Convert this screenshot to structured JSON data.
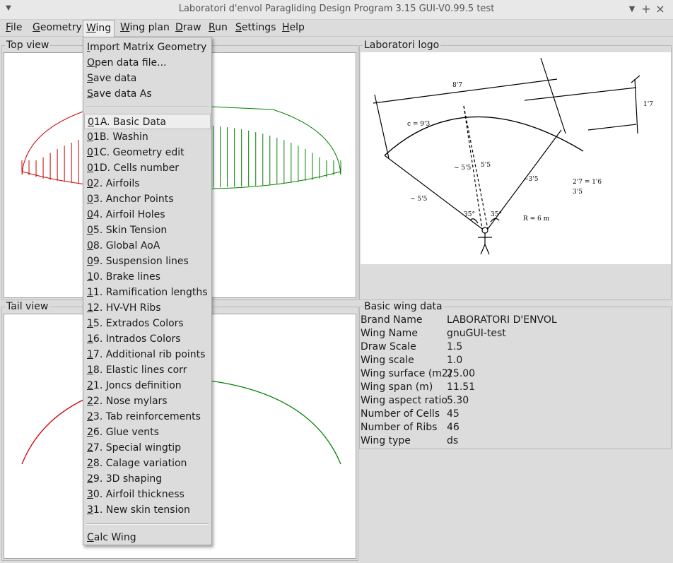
{
  "window": {
    "title": "Laboratori d'envol Paragliding Design Program 3.15 GUI-V0.99.5 test",
    "icon_name": "window-menu-icon",
    "buttons": [
      "chevron-down-icon",
      "maximize-icon",
      "close-icon"
    ]
  },
  "menubar": {
    "items": [
      {
        "mnemonic": "F",
        "rest": "ile"
      },
      {
        "mnemonic": "G",
        "rest": "eometry"
      },
      {
        "mnemonic": "W",
        "rest": "ing"
      },
      {
        "mnemonic": "W",
        "rest": "ing plan"
      },
      {
        "mnemonic": "D",
        "rest": "raw"
      },
      {
        "mnemonic": "R",
        "rest": "un"
      },
      {
        "mnemonic": "S",
        "rest": "ettings"
      },
      {
        "mnemonic": "H",
        "rest": "elp"
      }
    ]
  },
  "panels": {
    "top_view": "Top view",
    "logo": "Laboratori logo",
    "tail_view": "Tail view",
    "basic_data": "Basic wing data"
  },
  "colors": {
    "left_half": "#cc0000",
    "right_half": "#008000"
  },
  "basic_wing_data": [
    {
      "key": "Brand Name",
      "value": "LABORATORI D'ENVOL"
    },
    {
      "key": "Wing Name",
      "value": "gnuGUI-test"
    },
    {
      "key": "Draw Scale",
      "value": "1.5"
    },
    {
      "key": "Wing scale",
      "value": "1.0"
    },
    {
      "key": "Wing surface (m2)",
      "value": "25.00"
    },
    {
      "key": "Wing span (m)",
      "value": "11.51"
    },
    {
      "key": "Wing aspect ratio",
      "value": "5.30"
    },
    {
      "key": "Number of Cells",
      "value": "45"
    },
    {
      "key": "Number of Ribs",
      "value": "46"
    },
    {
      "key": "Wing type",
      "value": "ds"
    }
  ],
  "wing_menu": {
    "file_items": [
      {
        "mnemonic": "I",
        "rest": "mport Matrix Geometry"
      },
      {
        "mnemonic": "O",
        "rest": "pen data file..."
      },
      {
        "mnemonic": "S",
        "rest": "ave data"
      },
      {
        "mnemonic": "S",
        "rest": "ave data As"
      }
    ],
    "param_items": [
      {
        "mnemonic": "0",
        "rest": "1A. Basic Data"
      },
      {
        "mnemonic": "0",
        "rest": "1B. Washin"
      },
      {
        "mnemonic": "0",
        "rest": "1C. Geometry edit"
      },
      {
        "mnemonic": "0",
        "rest": "1D. Cells number"
      },
      {
        "mnemonic": "0",
        "rest": "2. Airfoils"
      },
      {
        "mnemonic": "0",
        "rest": "3. Anchor Points"
      },
      {
        "mnemonic": "0",
        "rest": "4. Airfoil Holes"
      },
      {
        "mnemonic": "0",
        "rest": "5. Skin Tension"
      },
      {
        "mnemonic": "0",
        "rest": "8. Global AoA"
      },
      {
        "mnemonic": "0",
        "rest": "9. Suspension lines"
      },
      {
        "mnemonic": "1",
        "rest": "0. Brake lines"
      },
      {
        "mnemonic": "1",
        "rest": "1. Ramification lengths"
      },
      {
        "mnemonic": "1",
        "rest": "2. HV-VH Ribs"
      },
      {
        "mnemonic": "1",
        "rest": "5. Extrados Colors"
      },
      {
        "mnemonic": "1",
        "rest": "6. Intrados Colors"
      },
      {
        "mnemonic": "1",
        "rest": "7. Additional rib points"
      },
      {
        "mnemonic": "1",
        "rest": "8. Elastic lines corr"
      },
      {
        "mnemonic": "2",
        "rest": "1. Joncs definition"
      },
      {
        "mnemonic": "2",
        "rest": "2. Nose mylars"
      },
      {
        "mnemonic": "2",
        "rest": "3. Tab reinforcements"
      },
      {
        "mnemonic": "2",
        "rest": "6. Glue vents"
      },
      {
        "mnemonic": "2",
        "rest": "7. Special wingtip"
      },
      {
        "mnemonic": "2",
        "rest": "8. Calage variation"
      },
      {
        "mnemonic": "2",
        "rest": "9. 3D shaping"
      },
      {
        "mnemonic": "3",
        "rest": "0. Airfoil thickness"
      },
      {
        "mnemonic": "3",
        "rest": "1. New skin tension"
      }
    ],
    "calc_item": {
      "mnemonic": "C",
      "rest": "alc Wing"
    }
  }
}
